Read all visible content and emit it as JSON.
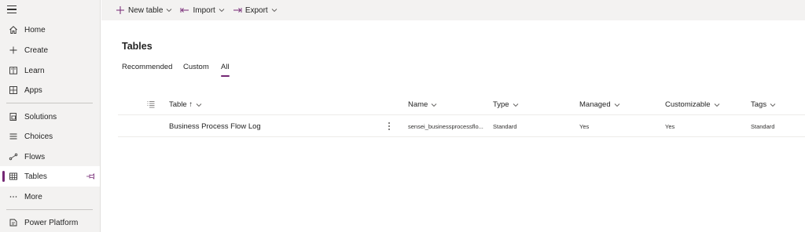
{
  "sidebar": {
    "items": [
      {
        "label": "Home",
        "icon": "home-icon"
      },
      {
        "label": "Create",
        "icon": "plus-icon"
      },
      {
        "label": "Learn",
        "icon": "book-icon"
      },
      {
        "label": "Apps",
        "icon": "apps-icon"
      },
      {
        "label": "Solutions",
        "icon": "solutions-icon"
      },
      {
        "label": "Choices",
        "icon": "list-icon"
      },
      {
        "label": "Flows",
        "icon": "flow-icon"
      },
      {
        "label": "Tables",
        "icon": "table-icon"
      },
      {
        "label": "More",
        "icon": "ellipsis-icon"
      },
      {
        "label": "Power Platform",
        "icon": "power-platform-icon"
      }
    ],
    "active": "Tables"
  },
  "toolbar": {
    "new_table": "New table",
    "import": "Import",
    "export": "Export"
  },
  "main": {
    "title": "Tables",
    "tabs": [
      "Recommended",
      "Custom",
      "All"
    ],
    "active_tab": "All"
  },
  "table": {
    "columns": {
      "table": "Table ↑",
      "name": "Name",
      "type": "Type",
      "managed": "Managed",
      "customizable": "Customizable",
      "tags": "Tags"
    },
    "rows": [
      {
        "table": "Business Process Flow Log",
        "name": "sensei_businessprocessflo...",
        "type": "Standard",
        "managed": "Yes",
        "customizable": "Yes",
        "tags": "Standard"
      }
    ]
  },
  "colors": {
    "accent": "#742774",
    "sidebar_bg": "#f3f2f1",
    "border": "#edebe9"
  }
}
